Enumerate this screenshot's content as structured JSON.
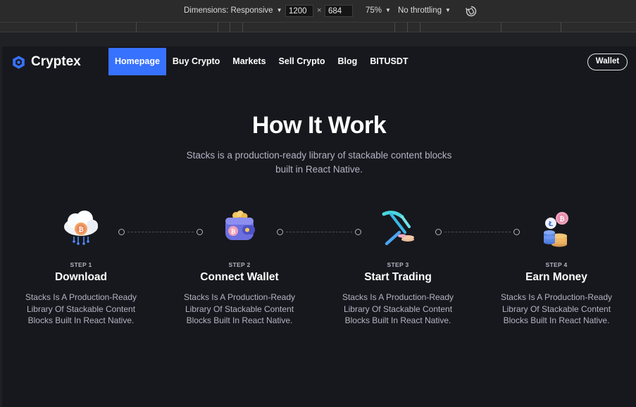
{
  "devtools": {
    "dimensions_label": "Dimensions: Responsive",
    "width_value": "1200",
    "height_value": "684",
    "times_symbol": "×",
    "zoom": "75%",
    "throttling": "No throttling"
  },
  "site": {
    "brand": "Cryptex",
    "nav": [
      {
        "label": "Homepage",
        "active": true
      },
      {
        "label": "Buy Crypto",
        "active": false
      },
      {
        "label": "Markets",
        "active": false
      },
      {
        "label": "Sell Crypto",
        "active": false
      },
      {
        "label": "Blog",
        "active": false
      },
      {
        "label": "BITUSDT",
        "active": false
      }
    ],
    "wallet_button": "Wallet",
    "title": "How It Work",
    "subtitle": "Stacks is a production-ready library of stackable content blocks built in React Native.",
    "steps": [
      {
        "number": "STEP 1",
        "title": "Download",
        "description": "Stacks Is A Production-Ready Library Of Stackable Content Blocks Built In React Native.",
        "icon": "cloud-download-icon"
      },
      {
        "number": "STEP 2",
        "title": "Connect Wallet",
        "description": "Stacks Is A Production-Ready Library Of Stackable Content Blocks Built In React Native.",
        "icon": "wallet-icon"
      },
      {
        "number": "STEP 3",
        "title": "Start Trading",
        "description": "Stacks Is A Production-Ready Library Of Stackable Content Blocks Built In React Native.",
        "icon": "pickaxe-icon"
      },
      {
        "number": "STEP 4",
        "title": "Earn Money",
        "description": "Stacks Is A Production-Ready Library Of Stackable Content Blocks Built In React Native.",
        "icon": "coin-stack-icon"
      }
    ]
  },
  "colors": {
    "accent": "#3772ff",
    "background": "#17181d",
    "muted_text": "#b1b5c3"
  }
}
